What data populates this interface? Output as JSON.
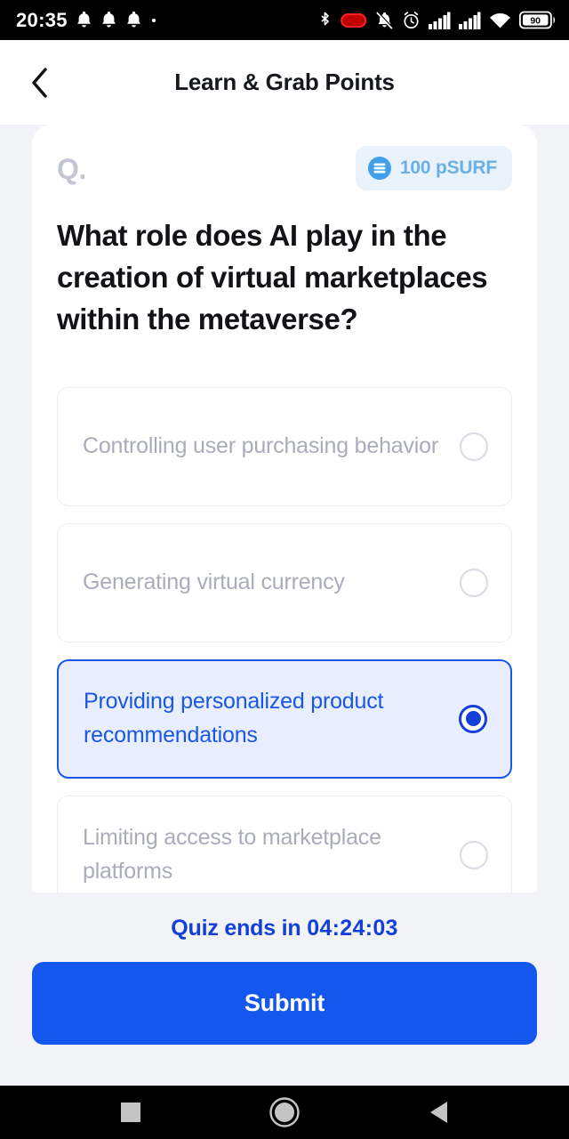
{
  "status_bar": {
    "time": "20:35",
    "left_icons": [
      "bell-icon",
      "bell-icon",
      "bell-icon",
      "dot-icon"
    ],
    "right_icons": [
      "bluetooth-icon",
      "recording-pill-icon",
      "bell-muted-icon",
      "alarm-icon",
      "signal-bars-icon",
      "signal-bars-icon",
      "wifi-icon"
    ],
    "battery_level": "90"
  },
  "header": {
    "back_icon": "chevron-left-icon",
    "title": "Learn & Grab Points"
  },
  "quiz": {
    "q_label": "Q.",
    "points": {
      "icon": "coin-stack-icon",
      "text": "100 pSURF"
    },
    "question": "What role does AI play in the creation of virtual marketplaces within the metaverse?",
    "options": [
      {
        "text": "Controlling user purchasing behavior",
        "selected": false
      },
      {
        "text": "Generating virtual currency",
        "selected": false
      },
      {
        "text": "Providing personalized product recommendations",
        "selected": true
      },
      {
        "text": "Limiting access to marketplace platforms",
        "selected": false
      }
    ]
  },
  "footer": {
    "timer_label": "Quiz ends in",
    "timer_value": "04:24:03",
    "submit_label": "Submit"
  },
  "nav_bar": {
    "recents_icon": "square-icon",
    "home_icon": "circle-icon",
    "back_icon": "triangle-left-icon"
  },
  "colors": {
    "accent_blue": "#1340d8",
    "submit_blue": "#1357ee",
    "badge_blue": "#6ab0e8",
    "muted_text": "#a9adbb"
  }
}
